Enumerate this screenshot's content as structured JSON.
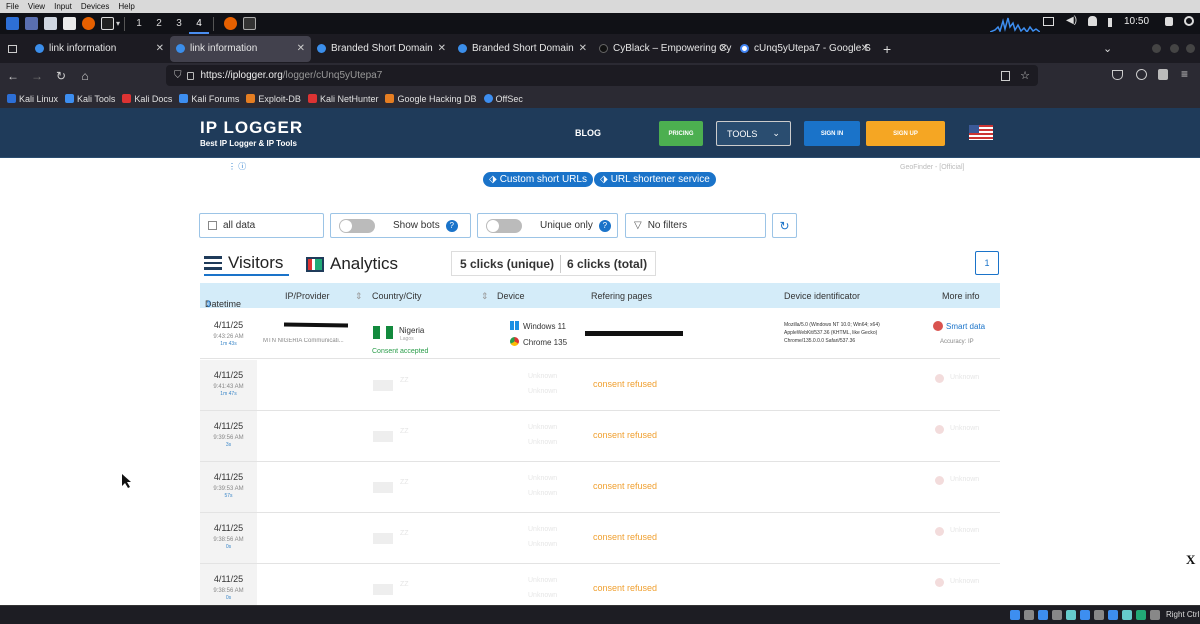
{
  "vm_menu": [
    "File",
    "View",
    "Input",
    "Devices",
    "Help"
  ],
  "workspaces": [
    "1",
    "2",
    "3",
    "4"
  ],
  "clock": "10:50",
  "tabs": [
    {
      "title": "link information",
      "active": false
    },
    {
      "title": "link information",
      "active": true
    },
    {
      "title": "Branded Short Domain",
      "active": false
    },
    {
      "title": "Branded Short Domain",
      "active": false
    },
    {
      "title": "CyBlack – Empowering Cy",
      "active": false
    },
    {
      "title": "cUnq5yUtepa7 - Google S",
      "active": false
    }
  ],
  "new_tab": "+",
  "url": {
    "host": "https://iplogger.org",
    "path": "/logger/cUnq5yUtepa7"
  },
  "bookmarks": [
    "Kali Linux",
    "Kali Tools",
    "Kali Docs",
    "Kali Forums",
    "Exploit-DB",
    "Kali NetHunter",
    "Google Hacking DB",
    "OffSec"
  ],
  "site": {
    "logo_title": "IP LOGGER",
    "logo_subtitle": "Best IP Logger & IP Tools",
    "nav": {
      "blog": "BLOG",
      "pricing": "PRICING",
      "tools": "TOOLS",
      "signin": "SIGN IN",
      "signup": "SIGN UP"
    },
    "geo_note": "GeoFinder - [Official]",
    "info_mark": "⋮ ⓘ"
  },
  "pills": [
    "Custom short URLs",
    "URL shortener service"
  ],
  "filters": {
    "date": "all data",
    "show_bots": "Show bots",
    "unique_only": "Unique only",
    "no_filters": "No filters"
  },
  "views": {
    "visitors": "Visitors",
    "analytics": "Analytics",
    "clicks_unique": "5 clicks (unique)",
    "clicks_total": "6 clicks (total)",
    "page": "1"
  },
  "table": {
    "headers": [
      "Datetime",
      "IP/Provider",
      "Country/City",
      "Device",
      "Refering pages",
      "Device identificator",
      "More info"
    ],
    "first_row": {
      "date": "4/11/25",
      "time": "9:43:26 AM",
      "dur": "1m 43s",
      "provider": "MTN NIGERIA Communicati...",
      "country": "Nigeria",
      "city": "Lagos",
      "consent": "Consent accepted",
      "os": "Windows 11",
      "browser": "Chrome 135",
      "ua_line1": "Mozilla/5.0 (Windows NT 10.0; Win64; x64)",
      "ua_line2": "AppleWebKit/537.36 (KHTML, like Gecko)",
      "ua_line3": "Chrome/135.0.0.0 Safari/537.36",
      "smart": "Smart data",
      "accuracy": "Accuracy: IP"
    },
    "rows": [
      {
        "date": "4/11/25",
        "time": "9:41:43 AM",
        "dur": "1m 47s",
        "status": "consent refused"
      },
      {
        "date": "4/11/25",
        "time": "9:39:56 AM",
        "dur": "3s",
        "status": "consent refused"
      },
      {
        "date": "4/11/25",
        "time": "9:39:53 AM",
        "dur": "57s",
        "status": "consent refused"
      },
      {
        "date": "4/11/25",
        "time": "9:38:56 AM",
        "dur": "0s",
        "status": "consent refused"
      },
      {
        "date": "4/11/25",
        "time": "9:38:56 AM",
        "dur": "0s",
        "status": "consent refused"
      }
    ],
    "ghost": {
      "unknown": "Unknown",
      "zz": "ZZ"
    }
  },
  "side_x": "X",
  "taskbar_right": "Right Ctrl",
  "colors": {
    "header_bg": "#1f3b5a",
    "pricing": "#4caf50",
    "signin": "#1a73c9",
    "signup": "#f5a623",
    "refused": "#f0a030",
    "accent": "#1a73c9"
  }
}
